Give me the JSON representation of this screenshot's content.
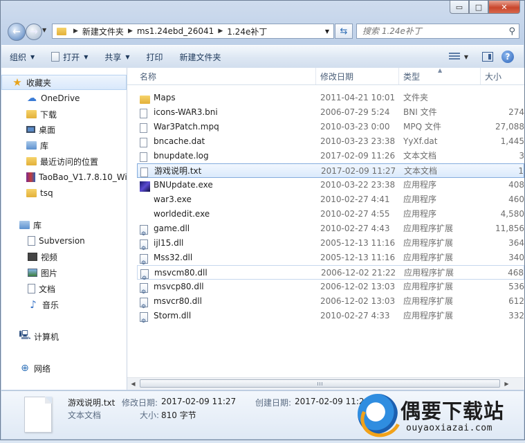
{
  "window": {
    "caption_buttons": {
      "minimize": "▭",
      "maximize": "□",
      "close": "✕"
    }
  },
  "address_bar": {
    "crumbs": [
      "新建文件夹",
      "ms1.24ebd_26041",
      "1.24e补丁"
    ]
  },
  "search": {
    "placeholder": "搜索 1.24e补丁"
  },
  "toolbar": {
    "organize": "组织",
    "open": "打开",
    "share": "共享",
    "print": "打印",
    "new_folder": "新建文件夹",
    "help": "?"
  },
  "sidebar": {
    "favorites": [
      {
        "label": "收藏夹",
        "icon": "star-icon"
      },
      {
        "label": "OneDrive",
        "icon": "onedrive-icon"
      },
      {
        "label": "下载",
        "icon": "downloads-folder-icon"
      },
      {
        "label": "桌面",
        "icon": "desktop-icon"
      },
      {
        "label": "库",
        "icon": "library-icon"
      },
      {
        "label": "最近访问的位置",
        "icon": "recent-places-icon"
      },
      {
        "label": "TaoBao_V1.7.8.10_Wi",
        "icon": "archive-icon"
      },
      {
        "label": "tsq",
        "icon": "folder-icon"
      }
    ],
    "libraries": [
      {
        "label": "库",
        "icon": "library-icon"
      },
      {
        "label": "Subversion",
        "icon": "document-library-icon"
      },
      {
        "label": "视频",
        "icon": "video-icon"
      },
      {
        "label": "图片",
        "icon": "pictures-icon"
      },
      {
        "label": "文档",
        "icon": "documents-icon"
      },
      {
        "label": "音乐",
        "icon": "music-icon"
      }
    ],
    "computer": {
      "label": "计算机",
      "icon": "computer-icon"
    },
    "network": {
      "label": "网络",
      "icon": "network-icon"
    }
  },
  "columns": {
    "name": "名称",
    "date": "修改日期",
    "type": "类型",
    "size": "大小"
  },
  "files": [
    {
      "name": "Maps",
      "date": "2011-04-21 10:01",
      "type": "文件夹",
      "size": "",
      "icon": "folder-icon"
    },
    {
      "name": "icons-WAR3.bni",
      "date": "2006-07-29 5:24",
      "type": "BNI 文件",
      "size": "274",
      "icon": "file-icon"
    },
    {
      "name": "War3Patch.mpq",
      "date": "2010-03-23 0:00",
      "type": "MPQ 文件",
      "size": "27,088",
      "icon": "file-icon"
    },
    {
      "name": "bncache.dat",
      "date": "2010-03-23 23:38",
      "type": "YyXf.dat",
      "size": "1,445",
      "icon": "file-icon"
    },
    {
      "name": "bnupdate.log",
      "date": "2017-02-09 11:26",
      "type": "文本文档",
      "size": "3",
      "icon": "text-file-icon"
    },
    {
      "name": "游戏说明.txt",
      "date": "2017-02-09 11:27",
      "type": "文本文档",
      "size": "1",
      "icon": "text-file-icon"
    },
    {
      "name": "BNUpdate.exe",
      "date": "2010-03-22 23:38",
      "type": "应用程序",
      "size": "408",
      "icon": "bnupdate-app-icon"
    },
    {
      "name": "war3.exe",
      "date": "2010-02-27 4:41",
      "type": "应用程序",
      "size": "460",
      "icon": "exe-icon"
    },
    {
      "name": "worldedit.exe",
      "date": "2010-02-27 4:55",
      "type": "应用程序",
      "size": "4,580",
      "icon": "exe-icon"
    },
    {
      "name": "game.dll",
      "date": "2010-02-27 4:43",
      "type": "应用程序扩展",
      "size": "11,856",
      "icon": "dll-icon"
    },
    {
      "name": "ijl15.dll",
      "date": "2005-12-13 11:16",
      "type": "应用程序扩展",
      "size": "364",
      "icon": "dll-icon"
    },
    {
      "name": "Mss32.dll",
      "date": "2005-12-13 11:16",
      "type": "应用程序扩展",
      "size": "340",
      "icon": "dll-icon"
    },
    {
      "name": "msvcm80.dll",
      "date": "2006-12-02 21:22",
      "type": "应用程序扩展",
      "size": "468",
      "icon": "dll-icon"
    },
    {
      "name": "msvcp80.dll",
      "date": "2006-12-02 13:03",
      "type": "应用程序扩展",
      "size": "536",
      "icon": "dll-icon"
    },
    {
      "name": "msvcr80.dll",
      "date": "2006-12-02 13:03",
      "type": "应用程序扩展",
      "size": "612",
      "icon": "dll-icon"
    },
    {
      "name": "Storm.dll",
      "date": "2010-02-27 4:33",
      "type": "应用程序扩展",
      "size": "332",
      "icon": "dll-icon"
    }
  ],
  "details": {
    "filename": "游戏说明.txt",
    "type": "文本文档",
    "modified_label": "修改日期:",
    "modified_value": "2017-02-09 11:27",
    "created_label": "创建日期:",
    "created_value": "2017-02-09 11:26",
    "size_label": "大小:",
    "size_value": "810 字节"
  },
  "watermark": {
    "title": "偶要下载站",
    "url": "ouyaoxiazai.com"
  }
}
